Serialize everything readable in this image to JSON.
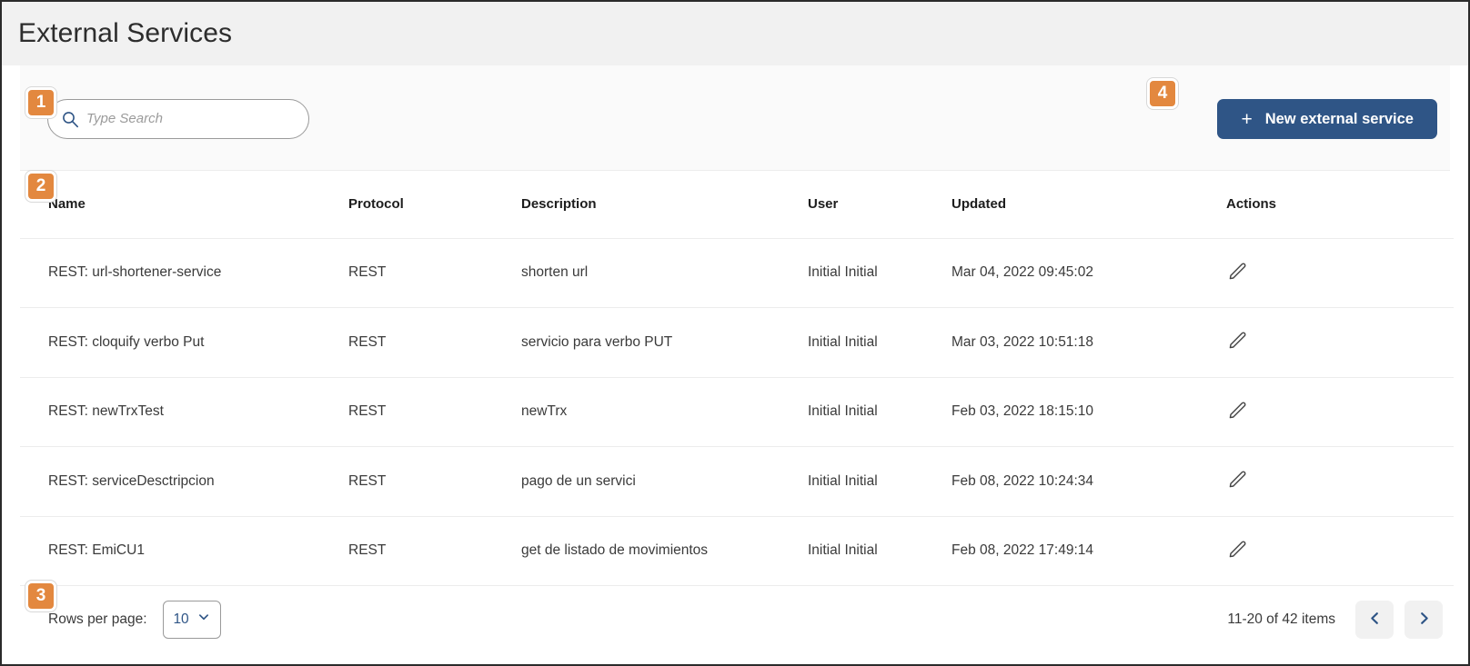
{
  "page": {
    "title": "External Services"
  },
  "toolbar": {
    "search": {
      "placeholder": "Type Search",
      "value": "",
      "icon": "search-icon"
    },
    "new_button": {
      "label": "New external service",
      "icon": "plus-icon",
      "color": "#2f5586"
    }
  },
  "table": {
    "columns": [
      "Name",
      "Protocol",
      "Description",
      "User",
      "Updated",
      "Actions"
    ],
    "rows": [
      {
        "name": "REST: url-shortener-service",
        "protocol": "REST",
        "description": "shorten url",
        "user": "Initial Initial",
        "updated": "Mar 04, 2022 09:45:02",
        "action_icon": "edit-pencil-icon"
      },
      {
        "name": "REST: cloquify verbo Put",
        "protocol": "REST",
        "description": "servicio para verbo PUT",
        "user": "Initial Initial",
        "updated": "Mar 03, 2022 10:51:18",
        "action_icon": "edit-pencil-icon"
      },
      {
        "name": "REST: newTrxTest",
        "protocol": "REST",
        "description": "newTrx",
        "user": "Initial Initial",
        "updated": "Feb 03, 2022 18:15:10",
        "action_icon": "edit-pencil-icon"
      },
      {
        "name": "REST: serviceDesctripcion",
        "protocol": "REST",
        "description": "pago de un servici",
        "user": "Initial Initial",
        "updated": "Feb 08, 2022 10:24:34",
        "action_icon": "edit-pencil-icon"
      },
      {
        "name": "REST: EmiCU1",
        "protocol": "REST",
        "description": "get de listado de movimientos",
        "user": "Initial Initial",
        "updated": "Feb 08, 2022 17:49:14",
        "action_icon": "edit-pencil-icon"
      }
    ]
  },
  "footer": {
    "rows_per_page_label": "Rows per page:",
    "rows_per_page_value": "10",
    "pagination_info": "11-20 of 42 items",
    "prev_icon": "chevron-left-icon",
    "next_icon": "chevron-right-icon"
  },
  "callouts": [
    {
      "number": "1",
      "target": "search-input"
    },
    {
      "number": "2",
      "target": "table-header"
    },
    {
      "number": "3",
      "target": "rows-per-page"
    },
    {
      "number": "4",
      "target": "new-external-service-button"
    }
  ],
  "colors": {
    "accent_blue": "#2f5586",
    "callout_orange": "#e3883f",
    "header_band": "#f1f1f1"
  }
}
